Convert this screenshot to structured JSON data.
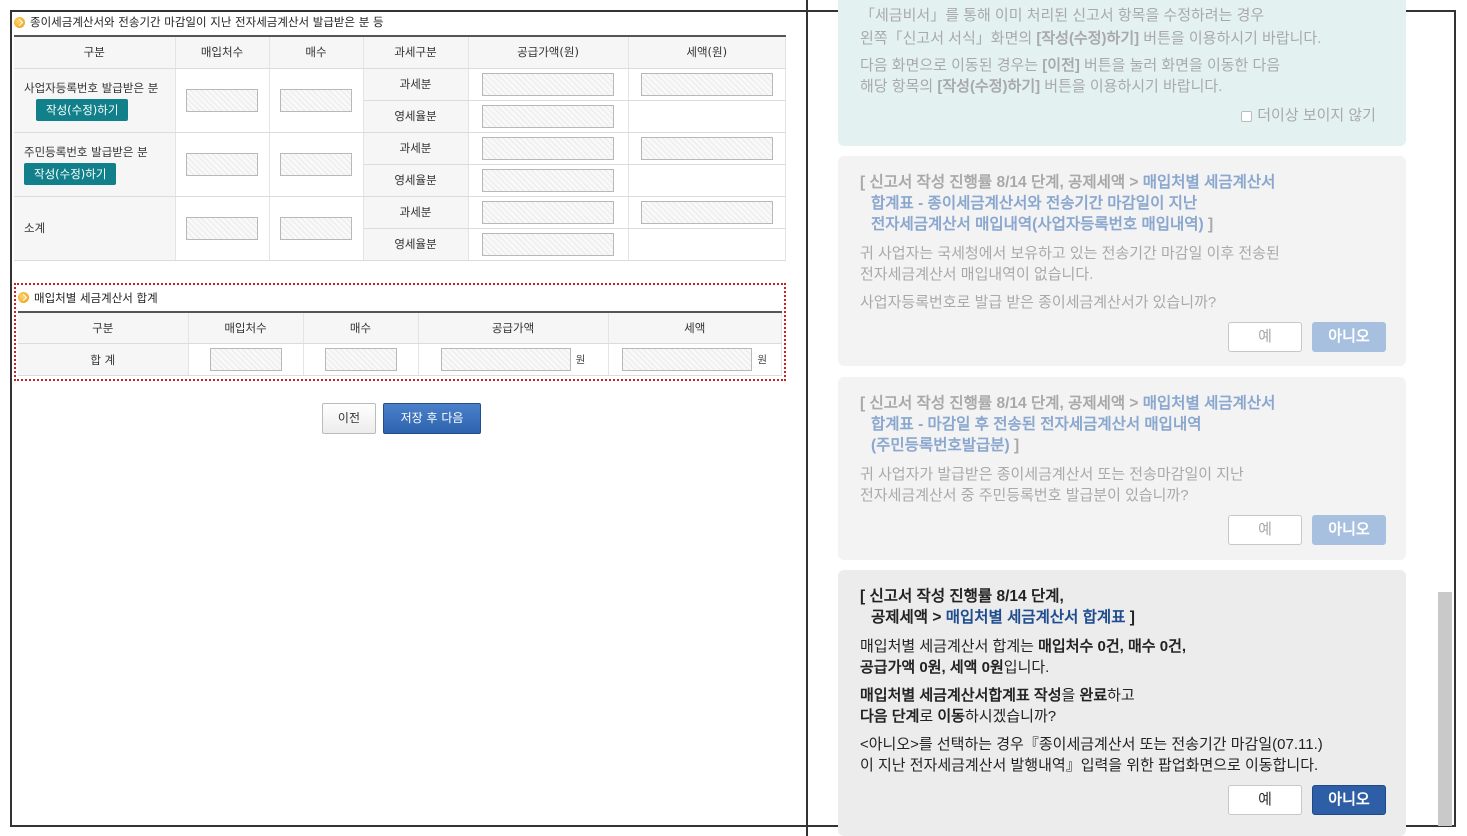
{
  "section1": {
    "title": "종이세금계산서와 전송기간 마감일이 지난 전자세금계산서 발급받은 분 등",
    "headers": [
      "구분",
      "매입처수",
      "매수",
      "과세구분",
      "공급가액(원)",
      "세액(원)"
    ],
    "rows": [
      {
        "label": "사업자등록번호 발급받은 분",
        "button": "작성(수정)하기",
        "sub1": "과세분",
        "sub2": "영세율분"
      },
      {
        "label": "주민등록번호 발급받은 분",
        "button": "작성(수정)하기",
        "sub1": "과세분",
        "sub2": "영세율분"
      },
      {
        "label": "소계",
        "sub1": "과세분",
        "sub2": "영세율분"
      }
    ]
  },
  "section2": {
    "title": "매입처별 세금계산서 합계",
    "headers": [
      "구분",
      "매입처수",
      "매수",
      "공급가액",
      "세액"
    ],
    "row_label": "합 계",
    "unit": "원"
  },
  "buttons": {
    "prev": "이전",
    "save_next": "저장 후 다음"
  },
  "info_card": {
    "line1": "「세금비서」를 통해 이미 처리된 신고서 항목을 수정하려는 경우",
    "line2a": "왼쪽「신고서 서식」화면의 ",
    "line2b": "[작성(수정)하기]",
    "line2c": " 버튼을 이용하시기 바랍니다.",
    "line3a": "다음 화면으로 이동된 경우는 ",
    "line3b": "[이전]",
    "line3c": " 버튼을 눌러 화면을 이동한 다음",
    "line4a": "해당 항목의 ",
    "line4b": "[작성(수정)하기]",
    "line4c": " 버튼을 이용하시기 바랍니다.",
    "dont_show": "더이상 보이지 않기"
  },
  "card1": {
    "title_a": "[ 신고서 작성 진행률 8/14 단계, 공제세액 > ",
    "title_b1": "매입처별 세금계산서",
    "title_b2": "합계표 - 종이세금계산서와 전송기간 마감일이 지난",
    "title_b3": "전자세금계산서 매입내역(사업자등록번호 매입내역)",
    "title_c": " ]",
    "body1": "귀 사업자는 국세청에서 보유하고 있는 전송기간 마감일 이후 전송된",
    "body2": "전자세금계산서 매입내역이 없습니다.",
    "body3": "사업자등록번호로 발급 받은 종이세금계산서가 있습니까?",
    "yes": "예",
    "no": "아니오"
  },
  "card2": {
    "title_a": "[ 신고서 작성 진행률 8/14 단계, 공제세액 > ",
    "title_b1": "매입처별 세금계산서",
    "title_b2": "합계표 - 마감일 후 전송된 전자세금계산서 매입내역",
    "title_b3": "(주민등록번호발급분)",
    "title_c": " ]",
    "body1": "귀 사업자가 발급받은 종이세금계산서 또는 전송마감일이 지난",
    "body2": "전자세금계산서 중 주민등록번호 발급분이 있습니까?",
    "yes": "예",
    "no": "아니오"
  },
  "card3": {
    "title_a": "[ 신고서 작성 진행률 8/14 단계,",
    "title_b": "공제세액 > ",
    "title_link": "매입처별 세금계산서 합계표",
    "title_c": " ]",
    "s1a": "매입처별 세금계산서 합계는 ",
    "s1b": "매입처수 0건, 매수 0건,",
    "s2a": "공급가액 0원, 세액 0원",
    "s2b": "입니다.",
    "s3a": "매입처별 세금계산서합계표 작성",
    "s3b": "을 ",
    "s3c": "완료",
    "s3d": "하고",
    "s4a": "다음 단계",
    "s4b": "로 ",
    "s4c": "이동",
    "s4d": "하시겠습니까?",
    "s5": "<아니오>를 선택하는 경우『종이세금계산서 또는 전송기간 마감일(07.11.)",
    "s6": "이 지난 전자세금계산서 발행내역』입력을 위한 팝업화면으로 이동합니다.",
    "yes": "예",
    "no": "아니오"
  }
}
